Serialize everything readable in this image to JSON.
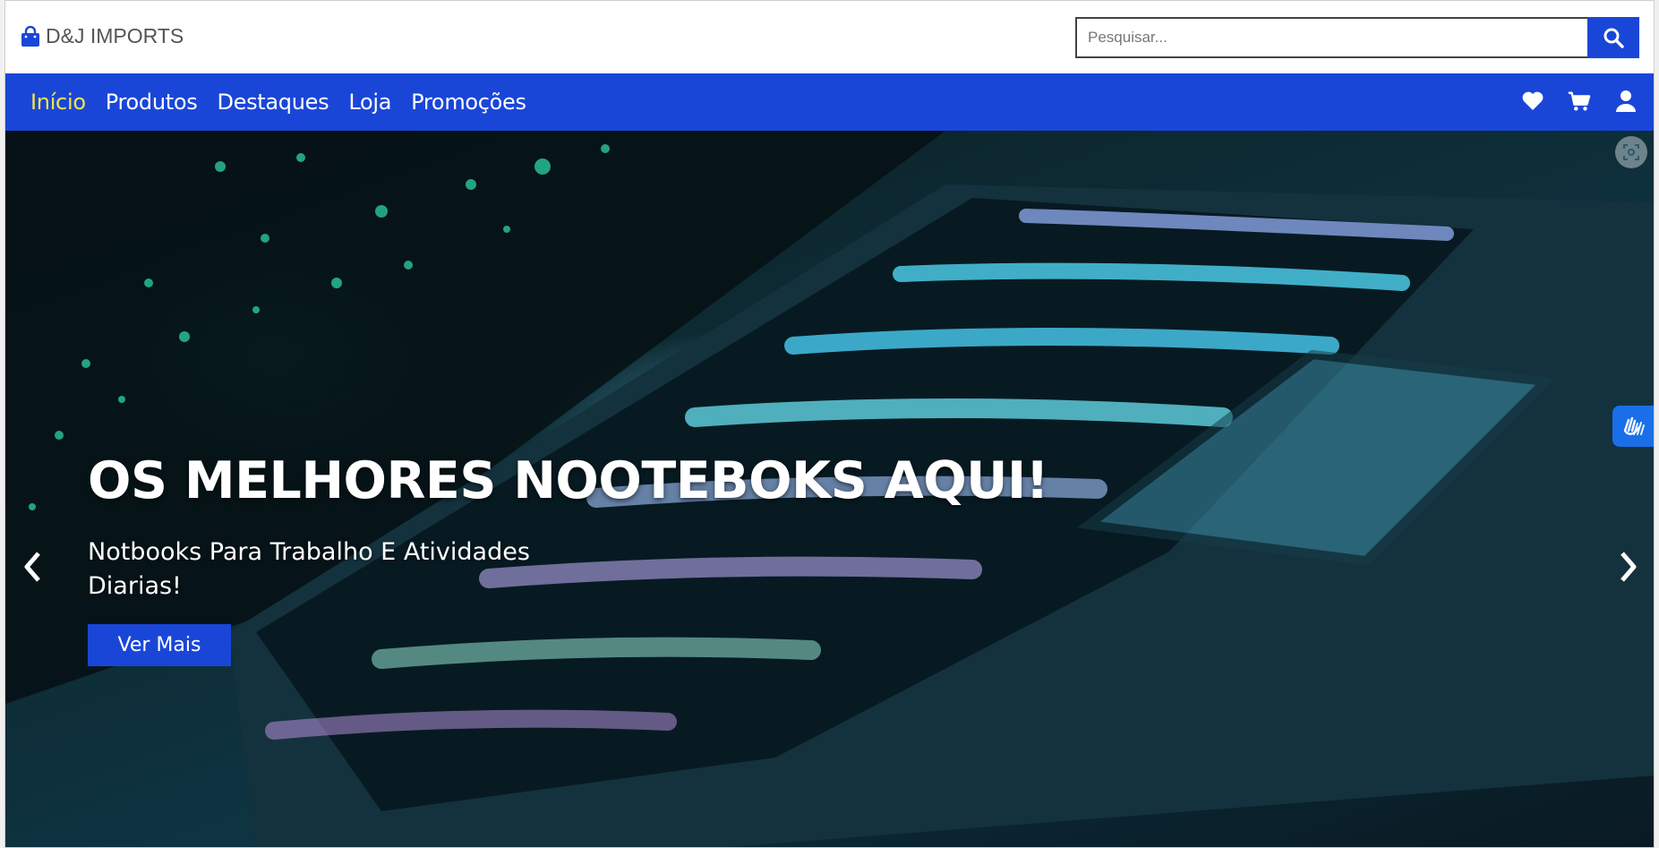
{
  "header": {
    "brand": "D&J IMPORTS",
    "search_placeholder": "Pesquisar...",
    "search_value": ""
  },
  "nav": {
    "links": [
      "Início",
      "Produtos",
      "Destaques",
      "Loja",
      "Promoções"
    ],
    "active_index": 0,
    "icons": [
      "heart-icon",
      "cart-icon",
      "user-icon"
    ]
  },
  "hero": {
    "title": "OS MELHORES NOOTEBOKS AQUI!",
    "subtitle": "Notbooks Para Trabalho E Atividades Diarias!",
    "button_label": "Ver Mais"
  },
  "colors": {
    "brand_blue": "#1a46d8",
    "active_link": "#f1e64a",
    "text_white": "#ffffff"
  }
}
